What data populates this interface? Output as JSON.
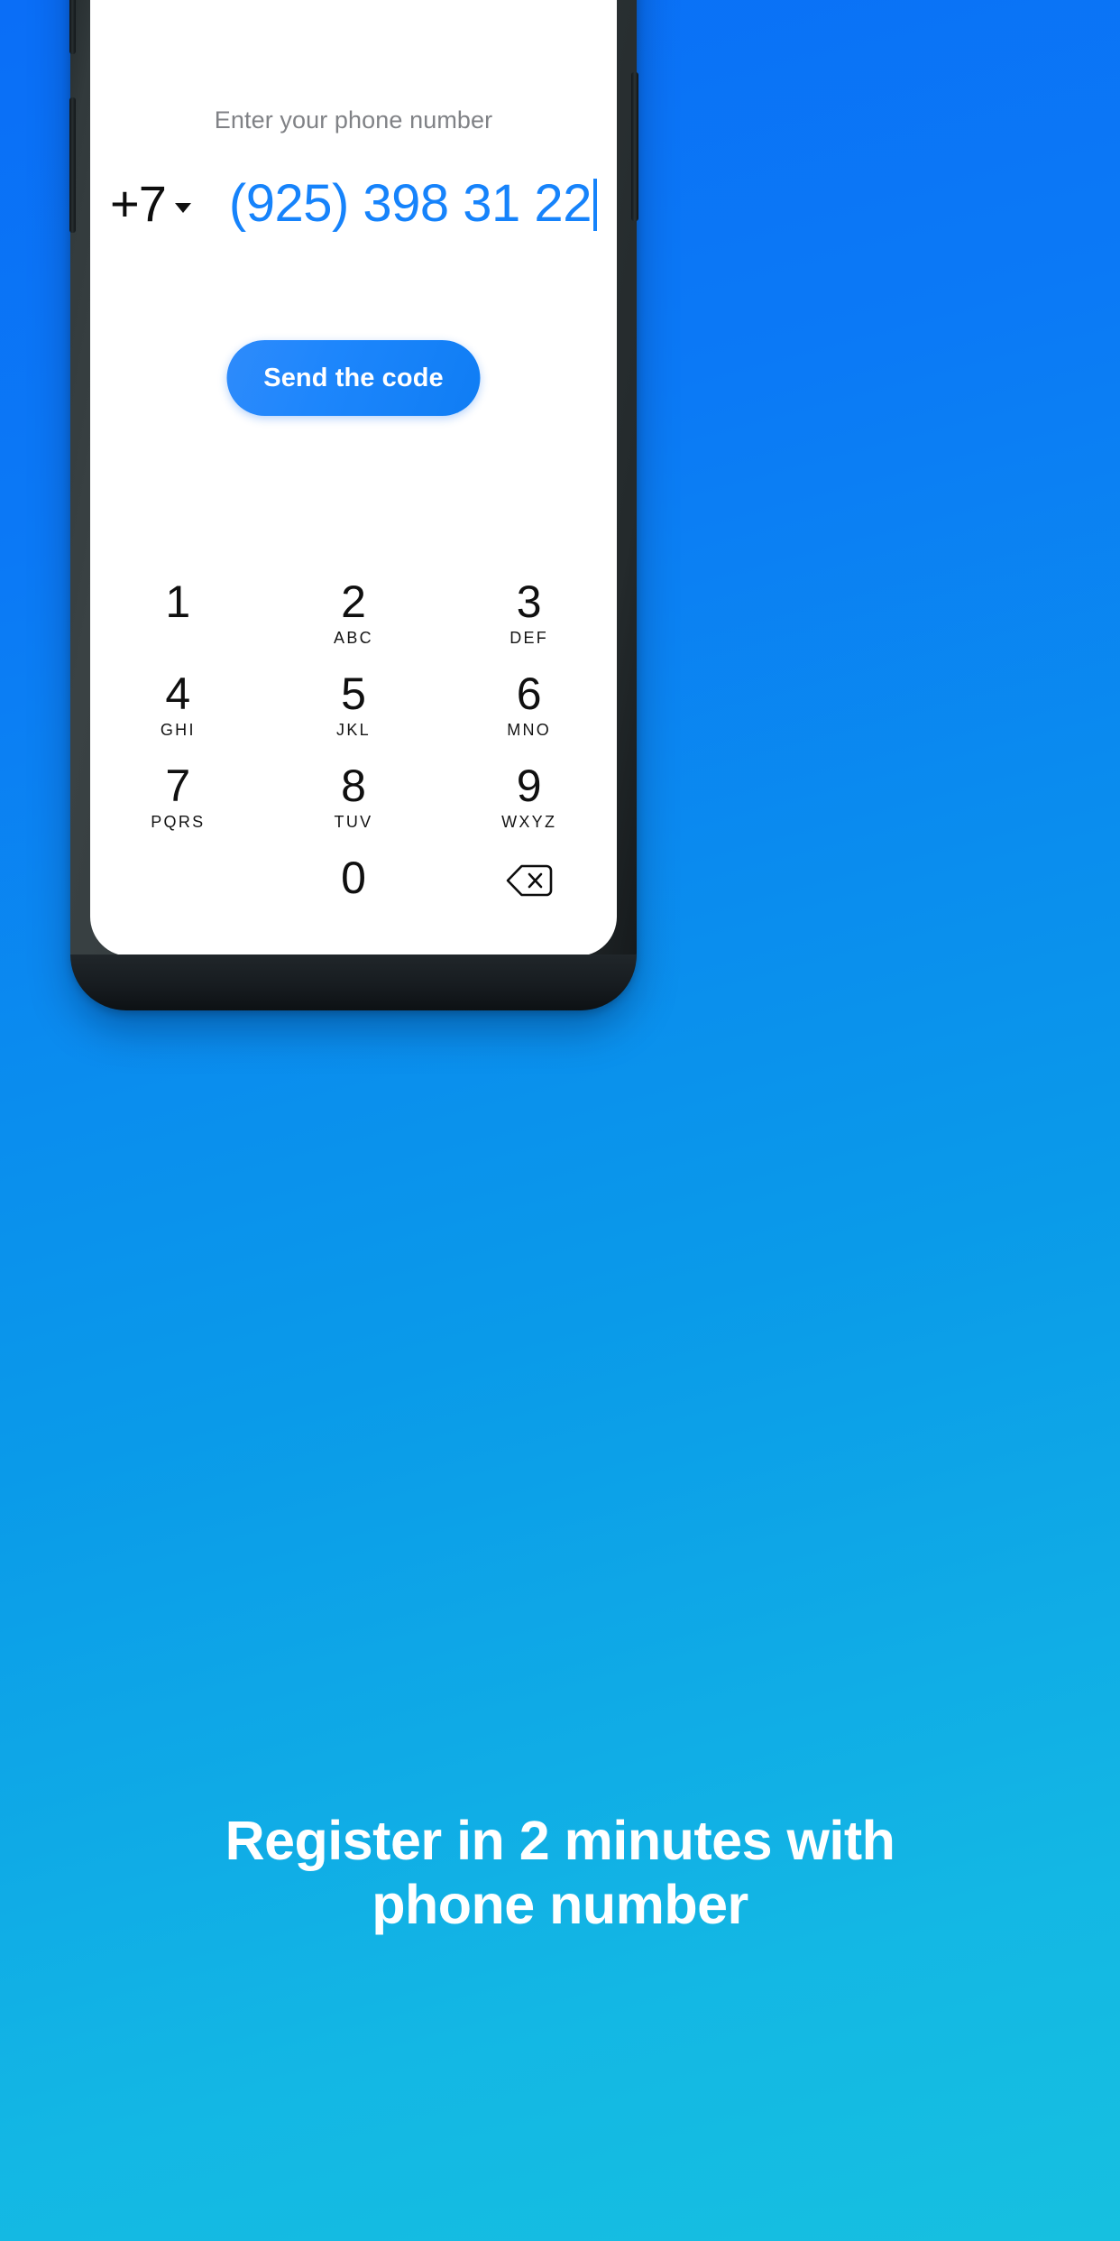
{
  "background": {
    "gradient_from": "#0A6EF7",
    "gradient_to": "#16C0E0"
  },
  "phone_screen": {
    "label": "Enter your phone number",
    "country_code": "+7",
    "country_code_dropdown_icon": "chevron-down-icon",
    "phone_number": "(925) 398 31 22",
    "phone_number_color": "#1683FB",
    "send_button": {
      "label": "Send the code",
      "color_from": "#2E8BFB",
      "color_to": "#0F7DF4",
      "text_color": "#FFFFFF"
    },
    "keypad": {
      "keys": [
        {
          "digit": "1",
          "letters": ""
        },
        {
          "digit": "2",
          "letters": "ABC"
        },
        {
          "digit": "3",
          "letters": "DEF"
        },
        {
          "digit": "4",
          "letters": "GHI"
        },
        {
          "digit": "5",
          "letters": "JKL"
        },
        {
          "digit": "6",
          "letters": "MNO"
        },
        {
          "digit": "7",
          "letters": "PQRS"
        },
        {
          "digit": "8",
          "letters": "TUV"
        },
        {
          "digit": "9",
          "letters": "WXYZ"
        },
        {
          "digit": "0",
          "letters": ""
        }
      ],
      "backspace_icon": "backspace-delete-icon"
    }
  },
  "caption": {
    "line1": "Register in 2 minutes with",
    "line2": "phone number"
  }
}
